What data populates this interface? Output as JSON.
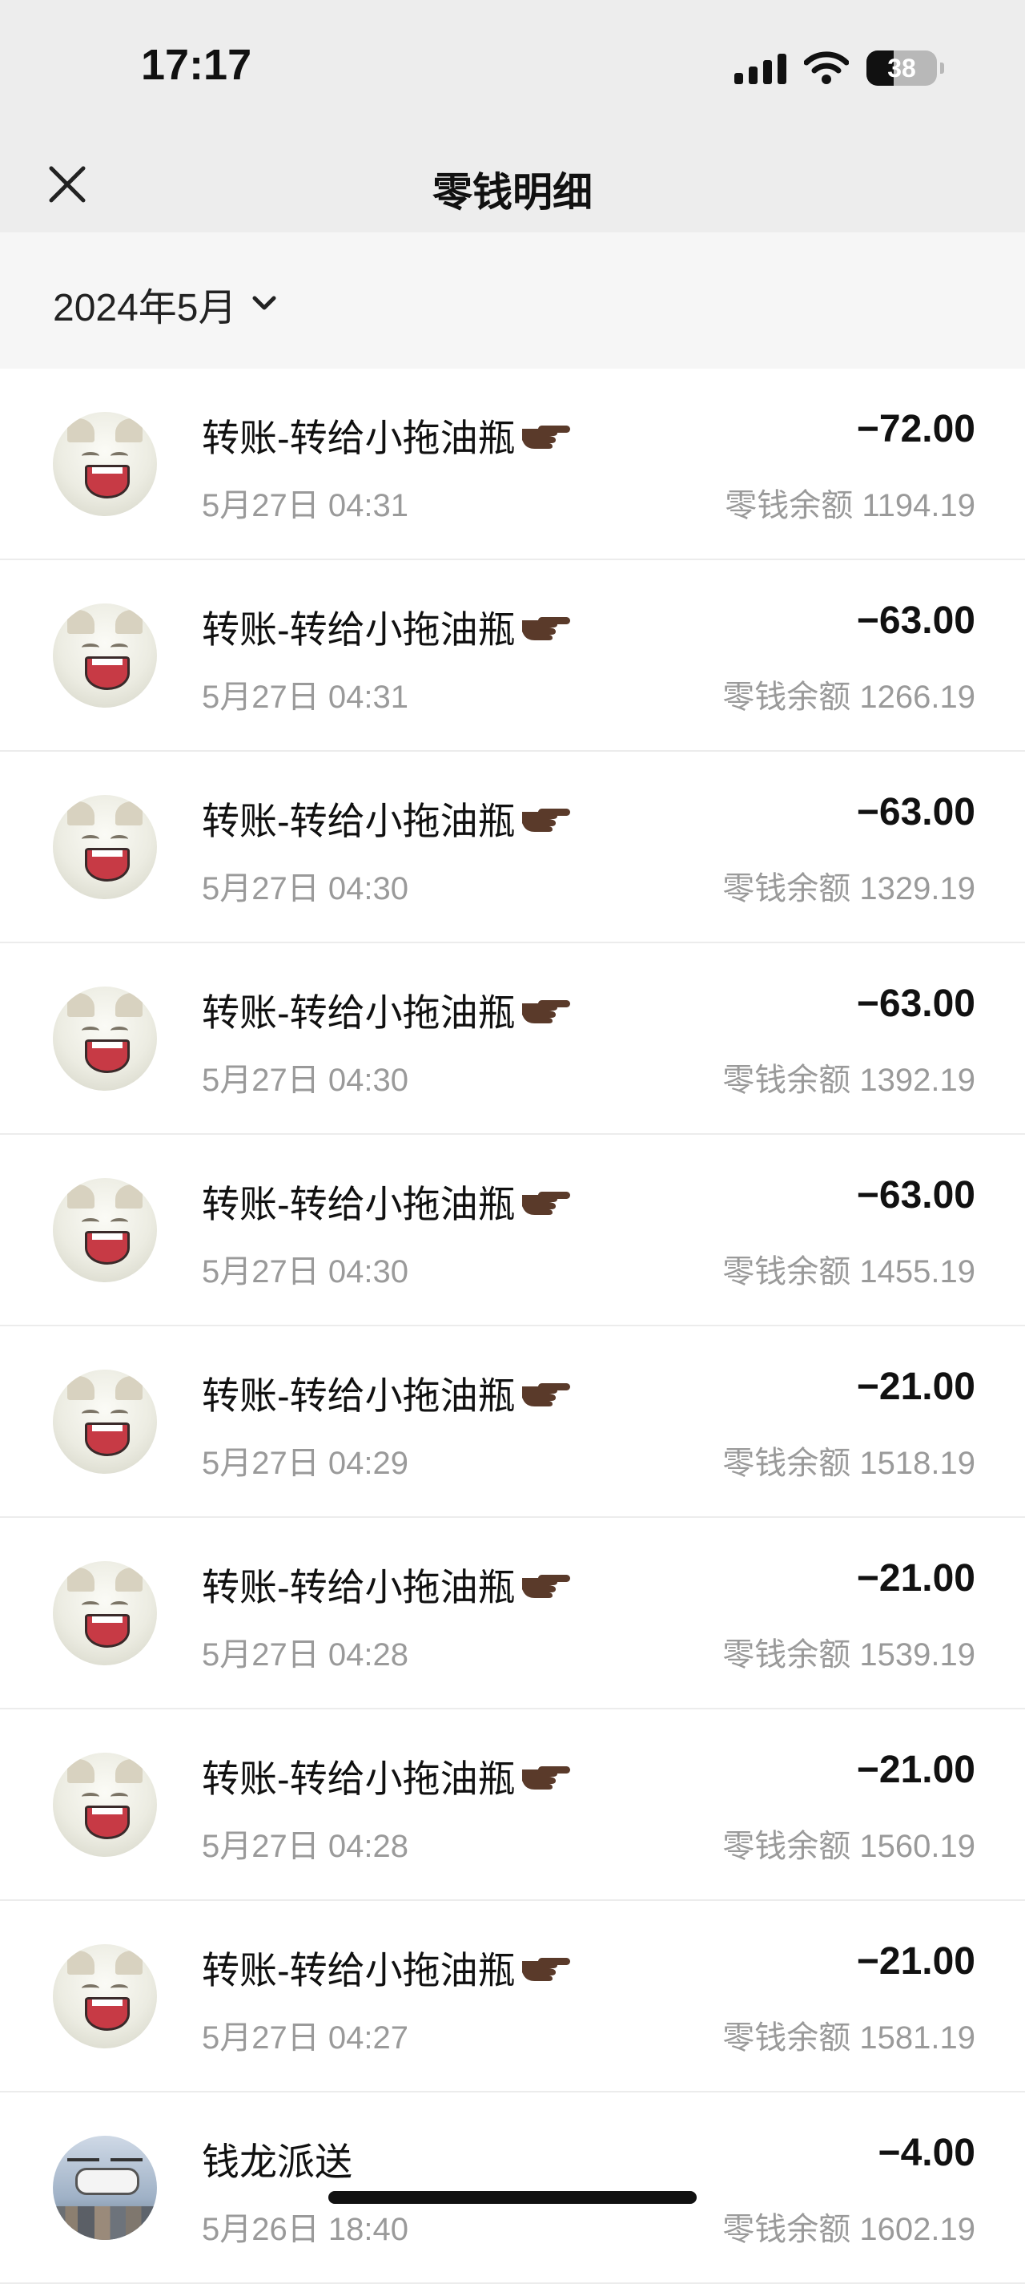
{
  "status_bar": {
    "time": "17:17",
    "battery": "38"
  },
  "nav": {
    "title": "零钱明细"
  },
  "month_selector": {
    "label": "2024年5月"
  },
  "transactions": [
    {
      "title": "转账-转给小拖油瓶",
      "date": "5月27日 04:31",
      "amount": "−72.00",
      "balance": "零钱余额 1194.19",
      "avatar": "cat"
    },
    {
      "title": "转账-转给小拖油瓶",
      "date": "5月27日 04:31",
      "amount": "−63.00",
      "balance": "零钱余额 1266.19",
      "avatar": "cat"
    },
    {
      "title": "转账-转给小拖油瓶",
      "date": "5月27日 04:30",
      "amount": "−63.00",
      "balance": "零钱余额 1329.19",
      "avatar": "cat"
    },
    {
      "title": "转账-转给小拖油瓶",
      "date": "5月27日 04:30",
      "amount": "−63.00",
      "balance": "零钱余额 1392.19",
      "avatar": "cat"
    },
    {
      "title": "转账-转给小拖油瓶",
      "date": "5月27日 04:30",
      "amount": "−63.00",
      "balance": "零钱余额 1455.19",
      "avatar": "cat"
    },
    {
      "title": "转账-转给小拖油瓶",
      "date": "5月27日 04:29",
      "amount": "−21.00",
      "balance": "零钱余额 1518.19",
      "avatar": "cat"
    },
    {
      "title": "转账-转给小拖油瓶",
      "date": "5月27日 04:28",
      "amount": "−21.00",
      "balance": "零钱余额 1539.19",
      "avatar": "cat"
    },
    {
      "title": "转账-转给小拖油瓶",
      "date": "5月27日 04:28",
      "amount": "−21.00",
      "balance": "零钱余额 1560.19",
      "avatar": "cat"
    },
    {
      "title": "转账-转给小拖油瓶",
      "date": "5月27日 04:27",
      "amount": "−21.00",
      "balance": "零钱余额 1581.19",
      "avatar": "cat"
    },
    {
      "title": "钱龙派送",
      "date": "5月26日 18:40",
      "amount": "−4.00",
      "balance": "零钱余额 1602.19",
      "avatar": "drone"
    }
  ],
  "icons": {
    "close": "close-icon",
    "chevron": "chevron-down-icon",
    "hand": "pointing-hand-icon",
    "signal": "cellular-signal-icon",
    "wifi": "wifi-icon",
    "battery": "battery-icon"
  }
}
